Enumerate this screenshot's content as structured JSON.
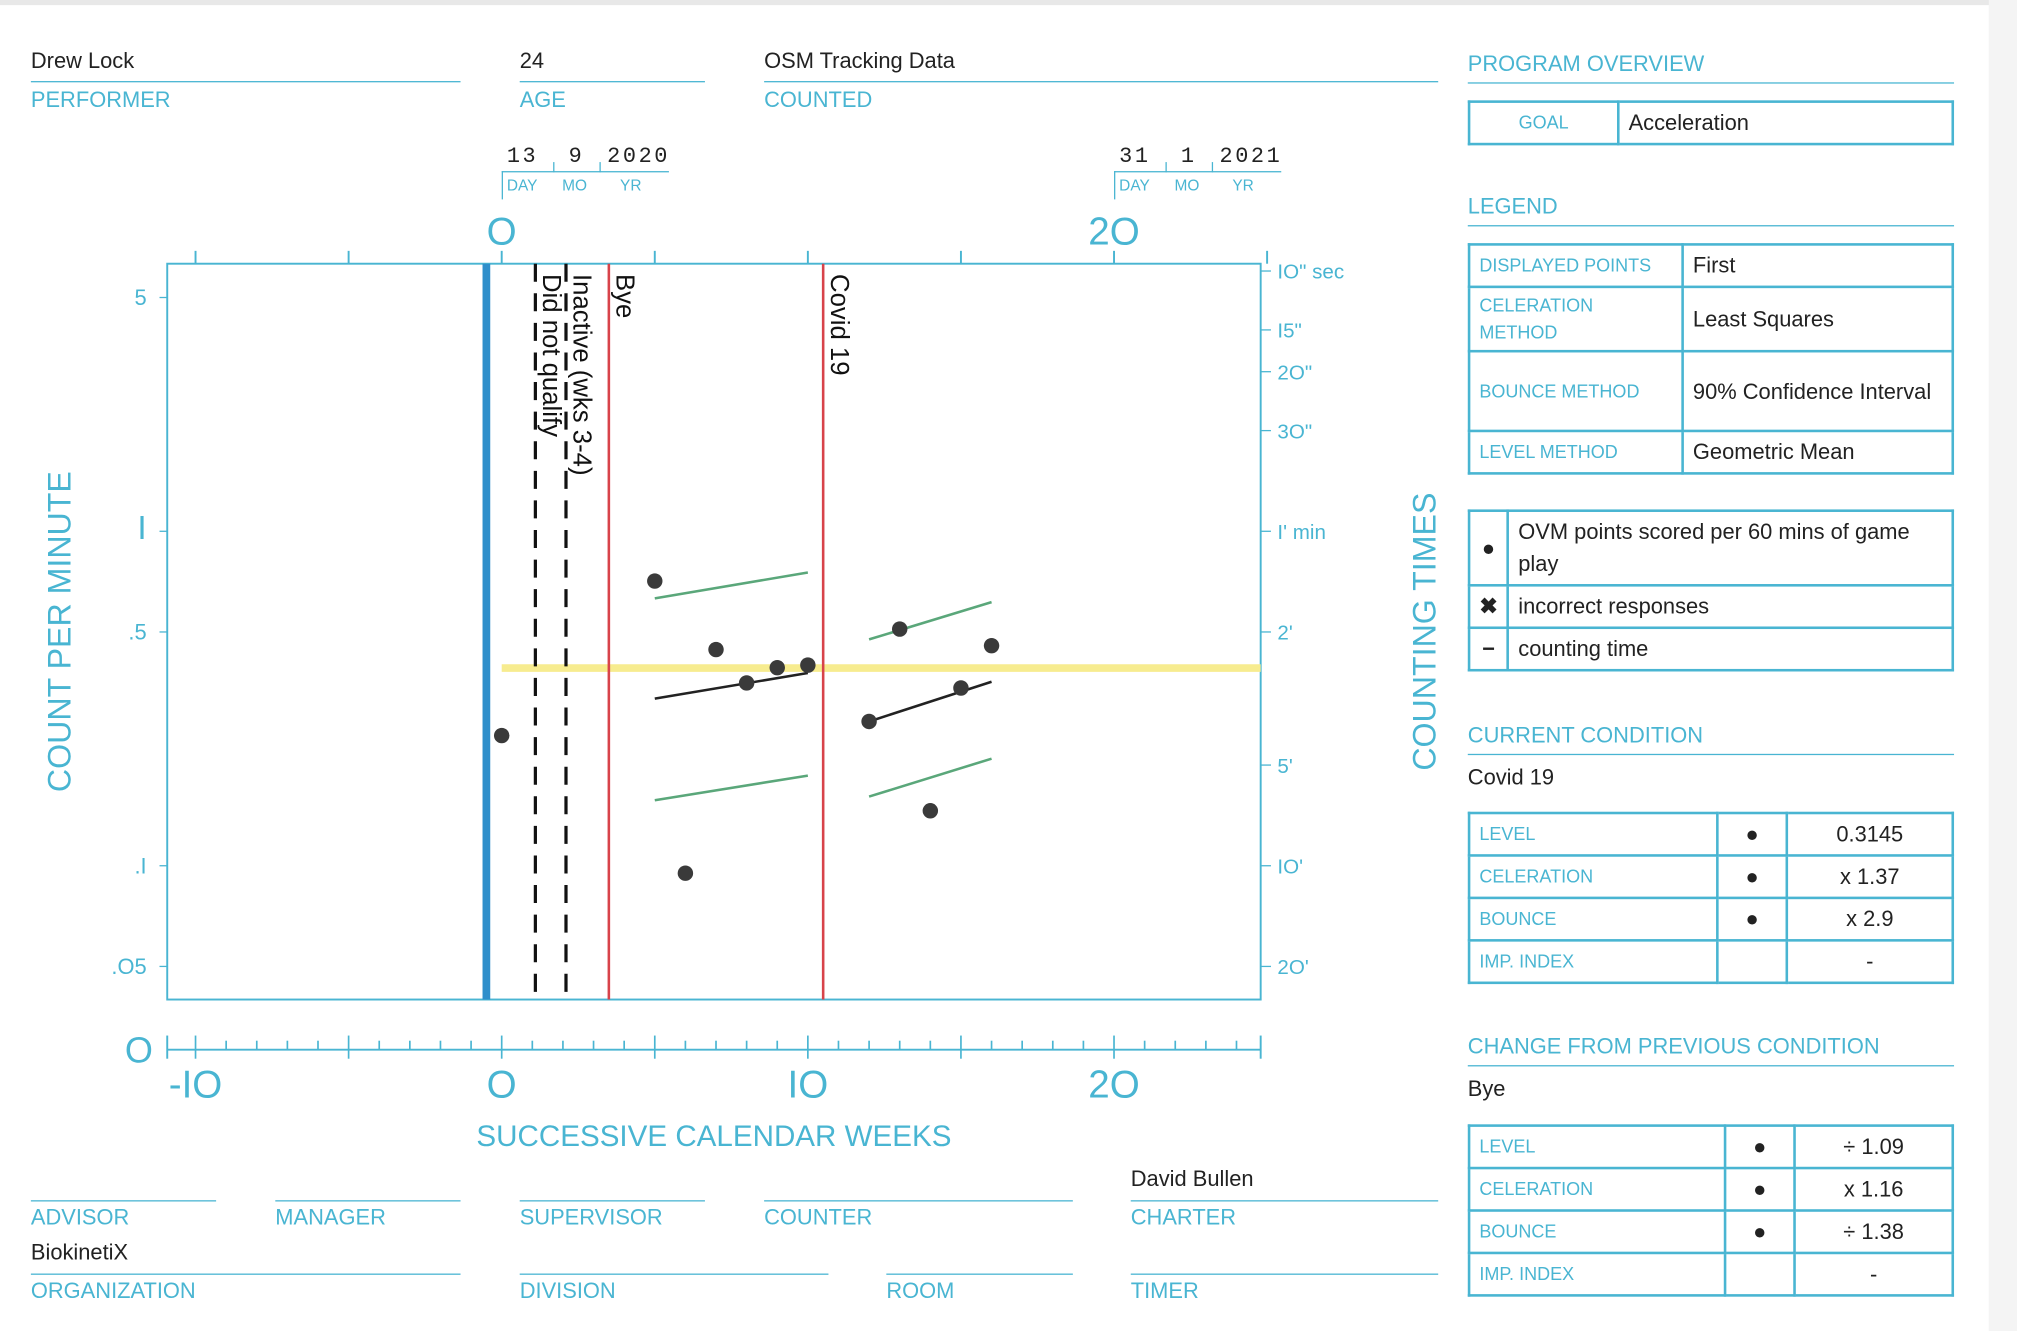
{
  "header": {
    "performer": {
      "label": "PERFORMER",
      "value": "Drew Lock"
    },
    "age": {
      "label": "AGE",
      "value": "24"
    },
    "counted": {
      "label": "COUNTED",
      "value": "OSM Tracking Data"
    }
  },
  "dates": [
    {
      "day": "13",
      "mo": "9",
      "yr": "2020",
      "day_label": "DAY",
      "mo_label": "MO",
      "yr_label": "YR"
    },
    {
      "day": "31",
      "mo": "1",
      "yr": "2021",
      "day_label": "DAY",
      "mo_label": "MO",
      "yr_label": "YR"
    }
  ],
  "chart_data": {
    "type": "scatter",
    "xlabel": "SUCCESSIVE CALENDAR WEEKS",
    "ylabel": "COUNT PER MINUTE",
    "ylabel_right": "COUNTING TIMES",
    "yscale": "log",
    "xlim": [
      -10.9,
      24.8
    ],
    "ylim": [
      0.042,
      5.6
    ],
    "x_ticks": [
      "-IO",
      "O",
      "IO",
      "2O"
    ],
    "x_tick_values": [
      -10,
      0,
      10,
      20
    ],
    "x_top_ticks": [
      "O",
      "2O"
    ],
    "x_top_tick_values": [
      0,
      20
    ],
    "x_zero_label": "O",
    "y_ticks": [
      {
        "v": 5,
        "label": "5"
      },
      {
        "v": 1,
        "label": "I"
      },
      {
        "v": 0.5,
        "label": ".5"
      },
      {
        "v": 0.1,
        "label": ".I"
      },
      {
        "v": 0.05,
        "label": ".O5"
      }
    ],
    "y_right_ticks": [
      {
        "v": 6,
        "label": "IO\" sec"
      },
      {
        "v": 4,
        "label": "I5\""
      },
      {
        "v": 3,
        "label": "2O\""
      },
      {
        "v": 2,
        "label": "3O\""
      },
      {
        "v": 1,
        "label": "I' min"
      },
      {
        "v": 0.5,
        "label": "2'"
      },
      {
        "v": 0.2,
        "label": "5'"
      },
      {
        "v": 0.1,
        "label": "IO'"
      },
      {
        "v": 0.05,
        "label": "2O'"
      }
    ],
    "points": [
      [
        0,
        0.245
      ],
      [
        5,
        0.71
      ],
      [
        6,
        0.095
      ],
      [
        7,
        0.443
      ],
      [
        8,
        0.352
      ],
      [
        9,
        0.391
      ],
      [
        10,
        0.398
      ],
      [
        12,
        0.27
      ],
      [
        13,
        0.51
      ],
      [
        14,
        0.146
      ],
      [
        15,
        0.34
      ],
      [
        16,
        0.455
      ]
    ],
    "celeration_lines": [
      {
        "kind": "celeration",
        "x": [
          5,
          10
        ],
        "y": [
          0.316,
          0.377
        ]
      },
      {
        "kind": "bounce-upper",
        "x": [
          5,
          10
        ],
        "y": [
          0.63,
          0.753
        ]
      },
      {
        "kind": "bounce-lower",
        "x": [
          5,
          10
        ],
        "y": [
          0.157,
          0.186
        ]
      },
      {
        "kind": "celeration",
        "x": [
          12,
          16
        ],
        "y": [
          0.27,
          0.355
        ]
      },
      {
        "kind": "bounce-upper",
        "x": [
          12,
          16
        ],
        "y": [
          0.475,
          0.614
        ]
      },
      {
        "kind": "bounce-lower",
        "x": [
          12,
          16
        ],
        "y": [
          0.161,
          0.209
        ]
      }
    ],
    "level_line": {
      "x": [
        0,
        24.8
      ],
      "y": 0.39
    },
    "phase_lines": [
      {
        "x": -0.5,
        "style": "start",
        "label": ""
      },
      {
        "x": 1.1,
        "style": "dashed",
        "label": "Did not qualify"
      },
      {
        "x": 2.1,
        "style": "dashed",
        "label": "Inactive (wks 3-4)"
      },
      {
        "x": 3.5,
        "style": "phase",
        "label": "Bye"
      },
      {
        "x": 10.5,
        "style": "phase",
        "label": "Covid 19"
      }
    ],
    "colors": {
      "axis": "#49b5d2",
      "point": "#3a3a3a",
      "celeration": "#222222",
      "bounce": "#5aa77a",
      "level": "#f7ec8f",
      "phase": "#d8434a",
      "start": "#2f8fcb"
    }
  },
  "program_overview": {
    "title": "PROGRAM OVERVIEW",
    "goal_label": "GOAL",
    "goal": "Acceleration"
  },
  "legend": {
    "title": "LEGEND",
    "rows": [
      {
        "k": "DISPLAYED POINTS",
        "v": "First"
      },
      {
        "k": "CELERATION METHOD",
        "v": "Least Squares"
      },
      {
        "k": "BOUNCE METHOD",
        "v": "90% Confidence Interval"
      },
      {
        "k": "LEVEL METHOD",
        "v": "Geometric Mean"
      }
    ],
    "symbols": [
      {
        "icon": "●",
        "text": "OVM points scored per 60 mins of game play"
      },
      {
        "icon": "✖",
        "text": "incorrect responses"
      },
      {
        "icon": "−",
        "text": "counting time"
      }
    ]
  },
  "current_condition": {
    "title": "CURRENT CONDITION",
    "name": "Covid 19",
    "rows": [
      {
        "k": "LEVEL",
        "icon": "●",
        "v": "0.3145"
      },
      {
        "k": "CELERATION",
        "icon": "●",
        "v": "x 1.37"
      },
      {
        "k": "BOUNCE",
        "icon": "●",
        "v": "x 2.9"
      },
      {
        "k": "IMP. INDEX",
        "icon": "",
        "v": "-"
      }
    ]
  },
  "change": {
    "title": "CHANGE FROM PREVIOUS CONDITION",
    "name": "Bye",
    "rows": [
      {
        "k": "LEVEL",
        "icon": "●",
        "v": "÷ 1.09"
      },
      {
        "k": "CELERATION",
        "icon": "●",
        "v": "x 1.16"
      },
      {
        "k": "BOUNCE",
        "icon": "●",
        "v": "÷ 1.38"
      },
      {
        "k": "IMP. INDEX",
        "icon": "",
        "v": "-"
      }
    ]
  },
  "footer": {
    "advisor": {
      "label": "ADVISOR",
      "value": ""
    },
    "manager": {
      "label": "MANAGER",
      "value": ""
    },
    "supervisor": {
      "label": "SUPERVISOR",
      "value": ""
    },
    "counter": {
      "label": "COUNTER",
      "value": ""
    },
    "charter": {
      "label": "CHARTER",
      "value": "David Bullen"
    },
    "organization": {
      "label": "ORGANIZATION",
      "value": "BiokinetiX"
    },
    "division": {
      "label": "DIVISION",
      "value": ""
    },
    "room": {
      "label": "ROOM",
      "value": ""
    },
    "timer": {
      "label": "TIMER",
      "value": ""
    }
  }
}
